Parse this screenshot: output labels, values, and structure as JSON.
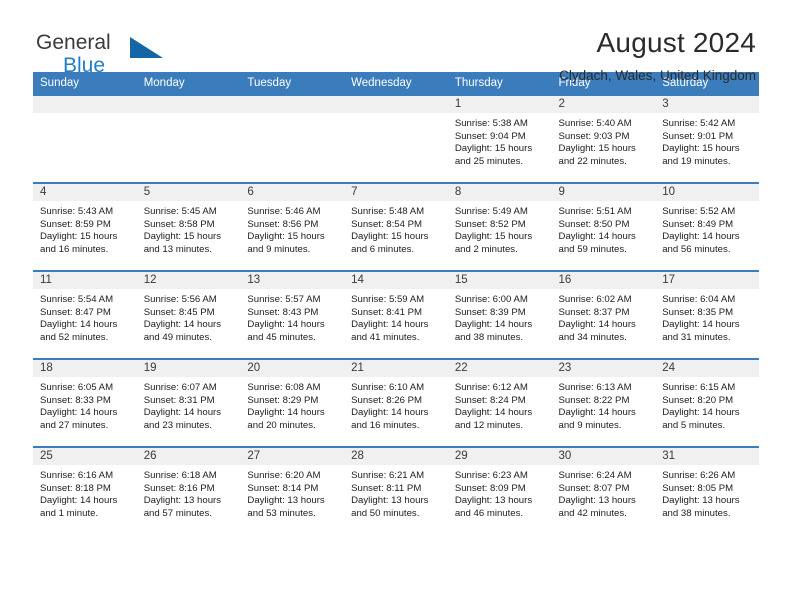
{
  "brand": {
    "name_top": "General",
    "name_bottom": "Blue",
    "mark": "triangle-logo",
    "color_primary": "#1466a6",
    "color_accent": "#1f7fc4"
  },
  "header": {
    "title": "August 2024",
    "location": "Clydach, Wales, United Kingdom"
  },
  "theme": {
    "header_blue": "#3b7cbd",
    "row_divider_blue": "#3b7cbd",
    "day_number_strip": "#f0f0f0"
  },
  "weekdays": [
    "Sunday",
    "Monday",
    "Tuesday",
    "Wednesday",
    "Thursday",
    "Friday",
    "Saturday"
  ],
  "weeks": [
    [
      {
        "day": "",
        "lines": []
      },
      {
        "day": "",
        "lines": []
      },
      {
        "day": "",
        "lines": []
      },
      {
        "day": "",
        "lines": []
      },
      {
        "day": "1",
        "lines": [
          "Sunrise: 5:38 AM",
          "Sunset: 9:04 PM",
          "Daylight: 15 hours",
          "and 25 minutes."
        ]
      },
      {
        "day": "2",
        "lines": [
          "Sunrise: 5:40 AM",
          "Sunset: 9:03 PM",
          "Daylight: 15 hours",
          "and 22 minutes."
        ]
      },
      {
        "day": "3",
        "lines": [
          "Sunrise: 5:42 AM",
          "Sunset: 9:01 PM",
          "Daylight: 15 hours",
          "and 19 minutes."
        ]
      }
    ],
    [
      {
        "day": "4",
        "lines": [
          "Sunrise: 5:43 AM",
          "Sunset: 8:59 PM",
          "Daylight: 15 hours",
          "and 16 minutes."
        ]
      },
      {
        "day": "5",
        "lines": [
          "Sunrise: 5:45 AM",
          "Sunset: 8:58 PM",
          "Daylight: 15 hours",
          "and 13 minutes."
        ]
      },
      {
        "day": "6",
        "lines": [
          "Sunrise: 5:46 AM",
          "Sunset: 8:56 PM",
          "Daylight: 15 hours",
          "and 9 minutes."
        ]
      },
      {
        "day": "7",
        "lines": [
          "Sunrise: 5:48 AM",
          "Sunset: 8:54 PM",
          "Daylight: 15 hours",
          "and 6 minutes."
        ]
      },
      {
        "day": "8",
        "lines": [
          "Sunrise: 5:49 AM",
          "Sunset: 8:52 PM",
          "Daylight: 15 hours",
          "and 2 minutes."
        ]
      },
      {
        "day": "9",
        "lines": [
          "Sunrise: 5:51 AM",
          "Sunset: 8:50 PM",
          "Daylight: 14 hours",
          "and 59 minutes."
        ]
      },
      {
        "day": "10",
        "lines": [
          "Sunrise: 5:52 AM",
          "Sunset: 8:49 PM",
          "Daylight: 14 hours",
          "and 56 minutes."
        ]
      }
    ],
    [
      {
        "day": "11",
        "lines": [
          "Sunrise: 5:54 AM",
          "Sunset: 8:47 PM",
          "Daylight: 14 hours",
          "and 52 minutes."
        ]
      },
      {
        "day": "12",
        "lines": [
          "Sunrise: 5:56 AM",
          "Sunset: 8:45 PM",
          "Daylight: 14 hours",
          "and 49 minutes."
        ]
      },
      {
        "day": "13",
        "lines": [
          "Sunrise: 5:57 AM",
          "Sunset: 8:43 PM",
          "Daylight: 14 hours",
          "and 45 minutes."
        ]
      },
      {
        "day": "14",
        "lines": [
          "Sunrise: 5:59 AM",
          "Sunset: 8:41 PM",
          "Daylight: 14 hours",
          "and 41 minutes."
        ]
      },
      {
        "day": "15",
        "lines": [
          "Sunrise: 6:00 AM",
          "Sunset: 8:39 PM",
          "Daylight: 14 hours",
          "and 38 minutes."
        ]
      },
      {
        "day": "16",
        "lines": [
          "Sunrise: 6:02 AM",
          "Sunset: 8:37 PM",
          "Daylight: 14 hours",
          "and 34 minutes."
        ]
      },
      {
        "day": "17",
        "lines": [
          "Sunrise: 6:04 AM",
          "Sunset: 8:35 PM",
          "Daylight: 14 hours",
          "and 31 minutes."
        ]
      }
    ],
    [
      {
        "day": "18",
        "lines": [
          "Sunrise: 6:05 AM",
          "Sunset: 8:33 PM",
          "Daylight: 14 hours",
          "and 27 minutes."
        ]
      },
      {
        "day": "19",
        "lines": [
          "Sunrise: 6:07 AM",
          "Sunset: 8:31 PM",
          "Daylight: 14 hours",
          "and 23 minutes."
        ]
      },
      {
        "day": "20",
        "lines": [
          "Sunrise: 6:08 AM",
          "Sunset: 8:29 PM",
          "Daylight: 14 hours",
          "and 20 minutes."
        ]
      },
      {
        "day": "21",
        "lines": [
          "Sunrise: 6:10 AM",
          "Sunset: 8:26 PM",
          "Daylight: 14 hours",
          "and 16 minutes."
        ]
      },
      {
        "day": "22",
        "lines": [
          "Sunrise: 6:12 AM",
          "Sunset: 8:24 PM",
          "Daylight: 14 hours",
          "and 12 minutes."
        ]
      },
      {
        "day": "23",
        "lines": [
          "Sunrise: 6:13 AM",
          "Sunset: 8:22 PM",
          "Daylight: 14 hours",
          "and 9 minutes."
        ]
      },
      {
        "day": "24",
        "lines": [
          "Sunrise: 6:15 AM",
          "Sunset: 8:20 PM",
          "Daylight: 14 hours",
          "and 5 minutes."
        ]
      }
    ],
    [
      {
        "day": "25",
        "lines": [
          "Sunrise: 6:16 AM",
          "Sunset: 8:18 PM",
          "Daylight: 14 hours",
          "and 1 minute."
        ]
      },
      {
        "day": "26",
        "lines": [
          "Sunrise: 6:18 AM",
          "Sunset: 8:16 PM",
          "Daylight: 13 hours",
          "and 57 minutes."
        ]
      },
      {
        "day": "27",
        "lines": [
          "Sunrise: 6:20 AM",
          "Sunset: 8:14 PM",
          "Daylight: 13 hours",
          "and 53 minutes."
        ]
      },
      {
        "day": "28",
        "lines": [
          "Sunrise: 6:21 AM",
          "Sunset: 8:11 PM",
          "Daylight: 13 hours",
          "and 50 minutes."
        ]
      },
      {
        "day": "29",
        "lines": [
          "Sunrise: 6:23 AM",
          "Sunset: 8:09 PM",
          "Daylight: 13 hours",
          "and 46 minutes."
        ]
      },
      {
        "day": "30",
        "lines": [
          "Sunrise: 6:24 AM",
          "Sunset: 8:07 PM",
          "Daylight: 13 hours",
          "and 42 minutes."
        ]
      },
      {
        "day": "31",
        "lines": [
          "Sunrise: 6:26 AM",
          "Sunset: 8:05 PM",
          "Daylight: 13 hours",
          "and 38 minutes."
        ]
      }
    ]
  ]
}
